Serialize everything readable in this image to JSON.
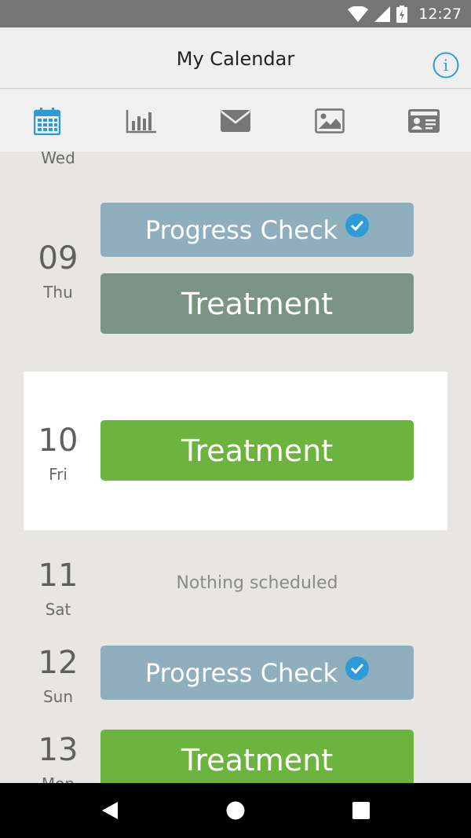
{
  "status_bar": {
    "time": "12:27"
  },
  "app_bar": {
    "title": "My Calendar"
  },
  "tabs": [
    {
      "icon": "calendar-icon",
      "active": true
    },
    {
      "icon": "bar-chart-icon",
      "active": false
    },
    {
      "icon": "mail-icon",
      "active": false
    },
    {
      "icon": "image-icon",
      "active": false
    },
    {
      "icon": "id-card-icon",
      "active": false
    }
  ],
  "days": [
    {
      "num": "",
      "name": "Wed"
    },
    {
      "num": "09",
      "name": "Thu",
      "events": [
        "Progress Check",
        "Treatment"
      ]
    },
    {
      "num": "10",
      "name": "Fri",
      "events": [
        "Treatment"
      ]
    },
    {
      "num": "11",
      "name": "Sat",
      "empty_text": "Nothing scheduled"
    },
    {
      "num": "12",
      "name": "Sun",
      "events": [
        "Progress Check"
      ]
    },
    {
      "num": "13",
      "name": "Mon",
      "events": [
        "Treatment"
      ]
    }
  ],
  "colors": {
    "progress_check": "#8fafbe",
    "treatment_past": "#7b9484",
    "treatment": "#6db43e",
    "accent": "#2e9bd6"
  }
}
